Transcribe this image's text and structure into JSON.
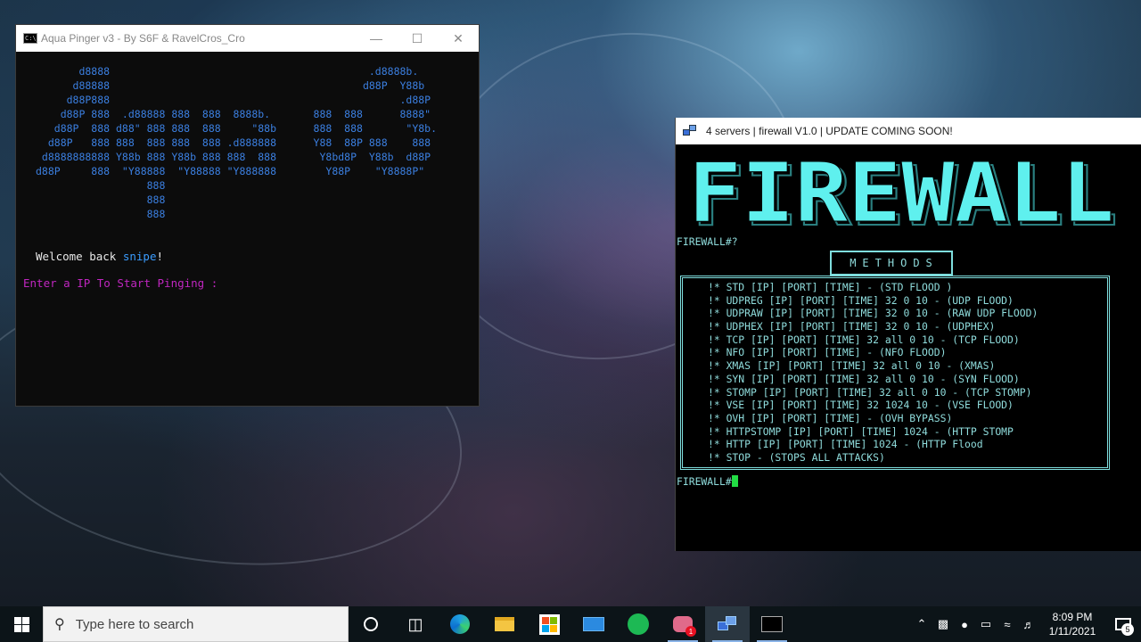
{
  "aqua": {
    "title": "Aqua Pinger v3 - By S6F & RavelCros_Cro",
    "ascii_lines": [
      "       d8888                                          .d8888b.",
      "      d88888                                         d88P  Y88b",
      "     d88P888                                               .d88P",
      "    d88P 888  .d88888 888  888  8888b.       888  888      8888\"",
      "   d88P  888 d88\" 888 888  888     \"88b      888  888       \"Y8b.",
      "  d88P   888 888  888 888  888 .d888888      Y88  88P 888    888",
      " d8888888888 Y88b 888 Y88b 888 888  888       Y8bd8P  Y88b  d88P",
      "d88P     888  \"Y88888  \"Y88888 \"Y888888        Y88P    \"Y8888P\"",
      "                  888",
      "                  888",
      "                  888"
    ],
    "welcome_prefix": "Welcome back ",
    "welcome_user": "snipe",
    "welcome_suffix": "!",
    "prompt": "Enter a IP To Start Pinging :"
  },
  "firewall": {
    "title": "4 servers | firewall V1.0 | UPDATE COMING SOON!",
    "logo_text": "FIREWALL",
    "prompt_line1": "FIREWALL#?",
    "methods_label": "METHODS",
    "methods": [
      "!* STD [IP] [PORT] [TIME] - (STD FLOOD )",
      "!* UDPREG [IP] [PORT] [TIME] 32 0 10 - (UDP FLOOD)",
      "!* UDPRAW [IP] [PORT] [TIME] 32 0 10 - (RAW UDP FLOOD)",
      "!* UDPHEX [IP] [PORT] [TIME] 32 0 10 - (UDPHEX)",
      "!* TCP [IP] [PORT] [TIME] 32 all 0 10 - (TCP FLOOD)",
      "!* NFO [IP] [PORT] [TIME] - (NFO FLOOD)",
      "!* XMAS [IP] [PORT] [TIME] 32 all 0 10 - (XMAS)",
      "!* SYN [IP] [PORT] [TIME] 32 all 0 10 - (SYN FLOOD)",
      "!* STOMP [IP] [PORT] [TIME] 32 all 0 10 - (TCP STOMP)",
      "!* VSE [IP] [PORT] [TIME] 32 1024 10 - (VSE FLOOD)",
      "!* OVH [IP] [PORT] [TIME] - (OVH BYPASS)",
      "!* HTTPSTOMP [IP] [PORT] [TIME] 1024 - (HTTP STOMP",
      "!* HTTP [IP] [PORT] [TIME] 1024 - (HTTP Flood",
      "!* STOP - (STOPS ALL ATTACKS)"
    ],
    "prompt_line2": "FIREWALL#"
  },
  "taskbar": {
    "search_placeholder": "Type here to search",
    "time": "8:09 PM",
    "date": "1/11/2021",
    "notification_count": "5",
    "discord_badge": "1"
  },
  "colors": {
    "aqua_ascii": "#3b7fe0",
    "aqua_prompt": "#c026c0",
    "firewall_text": "#8fdcdc",
    "firewall_logo": "#5ff0ee",
    "cursor": "#22dd44"
  }
}
